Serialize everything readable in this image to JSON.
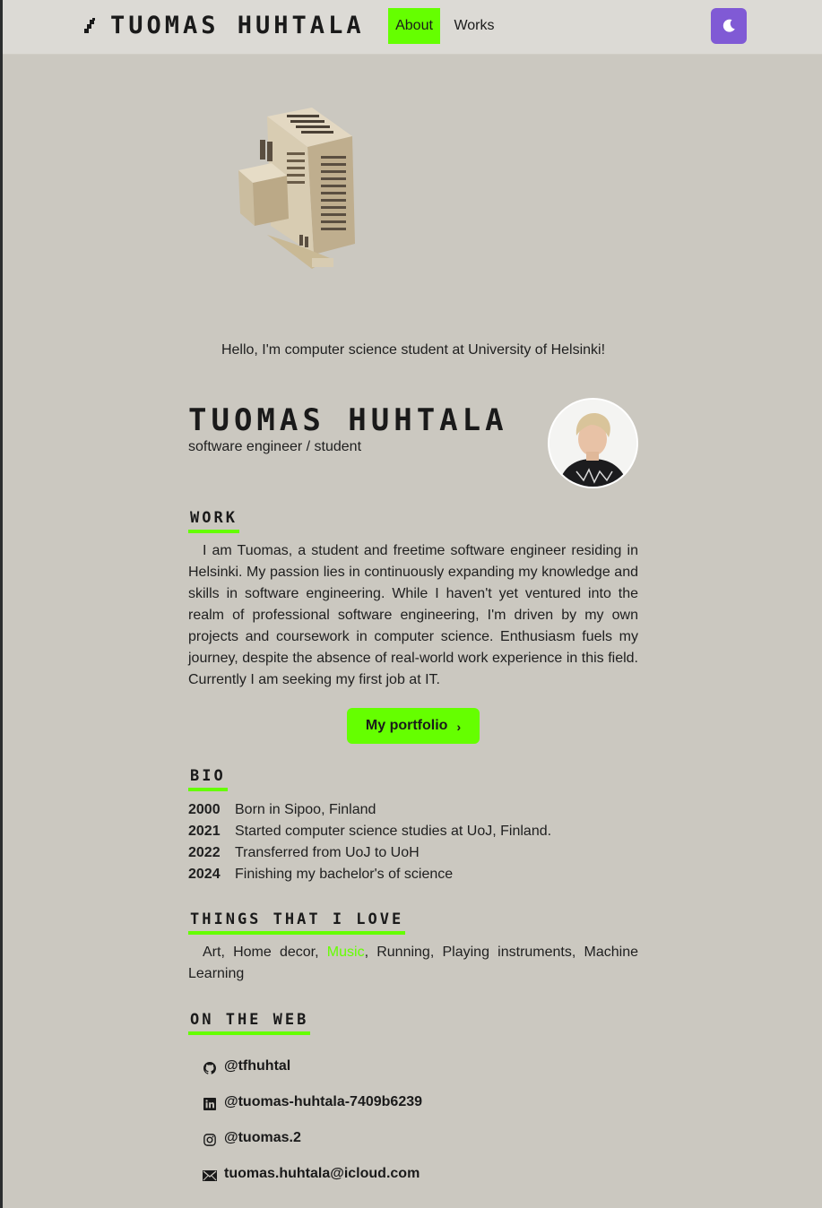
{
  "colors": {
    "accent": "#65ff00",
    "toggle": "#805ad5",
    "background": "#cbc8c0"
  },
  "header": {
    "title": "Tuomas Huhtala",
    "nav": {
      "about": "About",
      "works": "Works"
    },
    "theme_toggle_icon": "moon-icon"
  },
  "hero": {
    "greeting": "Hello, I'm computer science student at University of Helsinki!"
  },
  "profile": {
    "name": "Tuomas Huhtala",
    "role": "software engineer / student"
  },
  "work": {
    "heading": "Work",
    "text": "I am Tuomas, a student and freetime software engineer residing in Helsinki. My passion lies in continuously expanding my knowledge and skills in software engineering. While I haven't yet ventured into the realm of professional software engineering, I'm driven by my own projects and coursework in computer science. Enthusiasm fuels my journey, despite the absence of real-world work experience in this field. Currently I am seeking my first job at IT.",
    "button_label": "My portfolio"
  },
  "bio": {
    "heading": "Bio",
    "items": [
      {
        "year": "2000",
        "text": "Born in Sipoo, Finland"
      },
      {
        "year": "2021",
        "text": "Started computer science studies at UoJ, Finland."
      },
      {
        "year": "2022",
        "text": "Transferred from UoJ to UoH"
      },
      {
        "year": "2024",
        "text": "Finishing my bachelor's of science"
      }
    ]
  },
  "love": {
    "heading": "Things that I love",
    "before": "Art, Home decor, ",
    "highlight": "Music",
    "after": ", Running, Playing instruments, Machine Learning"
  },
  "web": {
    "heading": "On the web",
    "links": [
      {
        "icon": "github-icon",
        "label": "@tfhuhtal"
      },
      {
        "icon": "linkedin-icon",
        "label": "@tuomas-huhtala-7409b6239"
      },
      {
        "icon": "instagram-icon",
        "label": "@tuomas.2"
      },
      {
        "icon": "mail-icon",
        "label": "tuomas.huhtala@icloud.com"
      }
    ]
  }
}
